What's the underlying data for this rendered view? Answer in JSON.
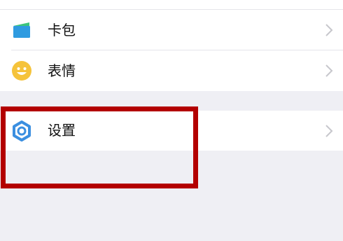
{
  "menu": {
    "items": [
      {
        "label": "卡包",
        "icon": "wallet-icon"
      },
      {
        "label": "表情",
        "icon": "smiley-icon"
      },
      {
        "label": "设置",
        "icon": "gear-icon"
      }
    ]
  },
  "colors": {
    "wallet_blue": "#2f9be0",
    "wallet_green": "#3cc47c",
    "smiley_yellow": "#f5c33b",
    "gear_blue": "#3b8fe0",
    "highlight_red": "#b30000",
    "chevron": "#c7c7cc"
  }
}
